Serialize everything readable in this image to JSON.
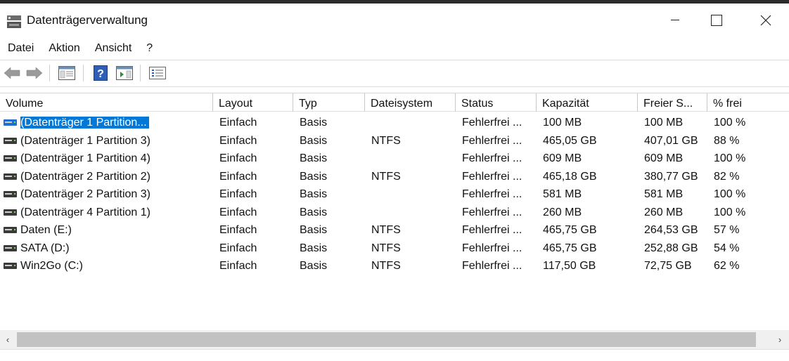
{
  "window": {
    "title": "Datenträgerverwaltung",
    "icon": "disk-management-icon",
    "controls": {
      "minimize": "minimize-icon",
      "maximize": "maximize-icon",
      "close": "close-icon"
    }
  },
  "menu": [
    "Datei",
    "Aktion",
    "Ansicht",
    "?"
  ],
  "toolbar": [
    "back-icon",
    "forward-icon",
    "console-tree-icon",
    "help-icon",
    "properties-icon",
    "checklist-icon"
  ],
  "columns": [
    "Volume",
    "Layout",
    "Typ",
    "Dateisystem",
    "Status",
    "Kapazität",
    "Freier S...",
    "% frei"
  ],
  "rows": [
    {
      "volume": "(Datenträger 1 Partition...",
      "layout": "Einfach",
      "typ": "Basis",
      "fs": "",
      "status": "Fehlerfrei ...",
      "capacity": "100 MB",
      "free": "100 MB",
      "pct": "100 %",
      "selected": true
    },
    {
      "volume": "(Datenträger 1 Partition 3)",
      "layout": "Einfach",
      "typ": "Basis",
      "fs": "NTFS",
      "status": "Fehlerfrei ...",
      "capacity": "465,05 GB",
      "free": "407,01 GB",
      "pct": "88 %"
    },
    {
      "volume": "(Datenträger 1 Partition 4)",
      "layout": "Einfach",
      "typ": "Basis",
      "fs": "",
      "status": "Fehlerfrei ...",
      "capacity": "609 MB",
      "free": "609 MB",
      "pct": "100 %"
    },
    {
      "volume": "(Datenträger 2 Partition 2)",
      "layout": "Einfach",
      "typ": "Basis",
      "fs": "NTFS",
      "status": "Fehlerfrei ...",
      "capacity": "465,18 GB",
      "free": "380,77 GB",
      "pct": "82 %"
    },
    {
      "volume": "(Datenträger 2 Partition 3)",
      "layout": "Einfach",
      "typ": "Basis",
      "fs": "",
      "status": "Fehlerfrei ...",
      "capacity": "581 MB",
      "free": "581 MB",
      "pct": "100 %"
    },
    {
      "volume": "(Datenträger 4 Partition 1)",
      "layout": "Einfach",
      "typ": "Basis",
      "fs": "",
      "status": "Fehlerfrei ...",
      "capacity": "260 MB",
      "free": "260 MB",
      "pct": "100 %"
    },
    {
      "volume": "Daten (E:)",
      "layout": "Einfach",
      "typ": "Basis",
      "fs": "NTFS",
      "status": "Fehlerfrei ...",
      "capacity": "465,75 GB",
      "free": "264,53 GB",
      "pct": "57 %"
    },
    {
      "volume": "SATA (D:)",
      "layout": "Einfach",
      "typ": "Basis",
      "fs": "NTFS",
      "status": "Fehlerfrei ...",
      "capacity": "465,75 GB",
      "free": "252,88 GB",
      "pct": "54 %"
    },
    {
      "volume": "Win2Go (C:)",
      "layout": "Einfach",
      "typ": "Basis",
      "fs": "NTFS",
      "status": "Fehlerfrei ...",
      "capacity": "117,50 GB",
      "free": "72,75 GB",
      "pct": "62 %"
    }
  ],
  "scrollbar": {
    "left_arrow": "‹",
    "right_arrow": "›"
  },
  "colors": {
    "selection": "#0078d7",
    "volume_icon_selected": "#1e6fd0",
    "volume_icon": "#3a3a3a"
  }
}
